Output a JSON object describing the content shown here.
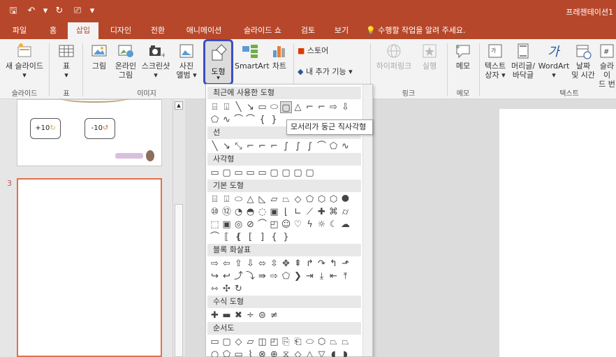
{
  "window": {
    "title": "프레젠테이션1"
  },
  "qat": [
    {
      "name": "save-icon",
      "glyph": "🖫"
    },
    {
      "name": "undo-icon",
      "glyph": "↶"
    },
    {
      "name": "undo-dropdown-icon",
      "glyph": "▾"
    },
    {
      "name": "redo-icon",
      "glyph": "↻"
    },
    {
      "name": "presenter-icon",
      "glyph": "⎚"
    },
    {
      "name": "customize-qat-icon",
      "glyph": "▾"
    }
  ],
  "tabs": [
    "파일",
    "홈",
    "삽입",
    "디자인",
    "전환",
    "애니메이션",
    "슬라이드 쇼",
    "검토",
    "보기"
  ],
  "active_tab": "삽입",
  "tell_me": "수행할 작업을 알려 주세요.",
  "ribbon": {
    "new_slide": [
      "새 슬라이드",
      "▾"
    ],
    "table": [
      "표",
      "▾"
    ],
    "pictures": "그림",
    "online_pictures": [
      "온라인",
      "그림"
    ],
    "screenshot": [
      "스크린샷",
      "▾"
    ],
    "photo_album": [
      "사진",
      "앨범 ▾"
    ],
    "shapes": [
      "도형",
      "▾"
    ],
    "smartart": "SmartArt",
    "chart": "차트",
    "store": "스토어",
    "my_addins": "내 추가 기능",
    "hyperlink": "하이퍼링크",
    "action": "실행",
    "comment": "메모",
    "textbox": [
      "텍스트",
      "상자 ▾"
    ],
    "header_footer": [
      "머리글/",
      "바닥글"
    ],
    "wordart": [
      "WordArt",
      "▾"
    ],
    "date_time": [
      "날짜",
      "및 시간"
    ],
    "slide_number": [
      "슬라이",
      "드 번"
    ],
    "groups": {
      "slides": "슬라이드",
      "tables": "표",
      "images": "이미지",
      "links": "링크",
      "comments": "메모",
      "text": "텍스트"
    }
  },
  "thumbnails": {
    "slide3_number": "3",
    "badge_plus": "+10",
    "badge_minus": "-10"
  },
  "shapes_menu": {
    "sections": {
      "recent": "최근에 사용한 도형",
      "lines": "선",
      "rectangles": "사각형",
      "basic": "기본 도형",
      "block_arrows": "블록 화살표",
      "equation": "수식 도형",
      "flowchart": "순서도"
    },
    "tooltip": "모서리가 둥근 직사각형"
  },
  "colors": {
    "accent": "#b7472a",
    "highlight": "#3b4fc4"
  }
}
